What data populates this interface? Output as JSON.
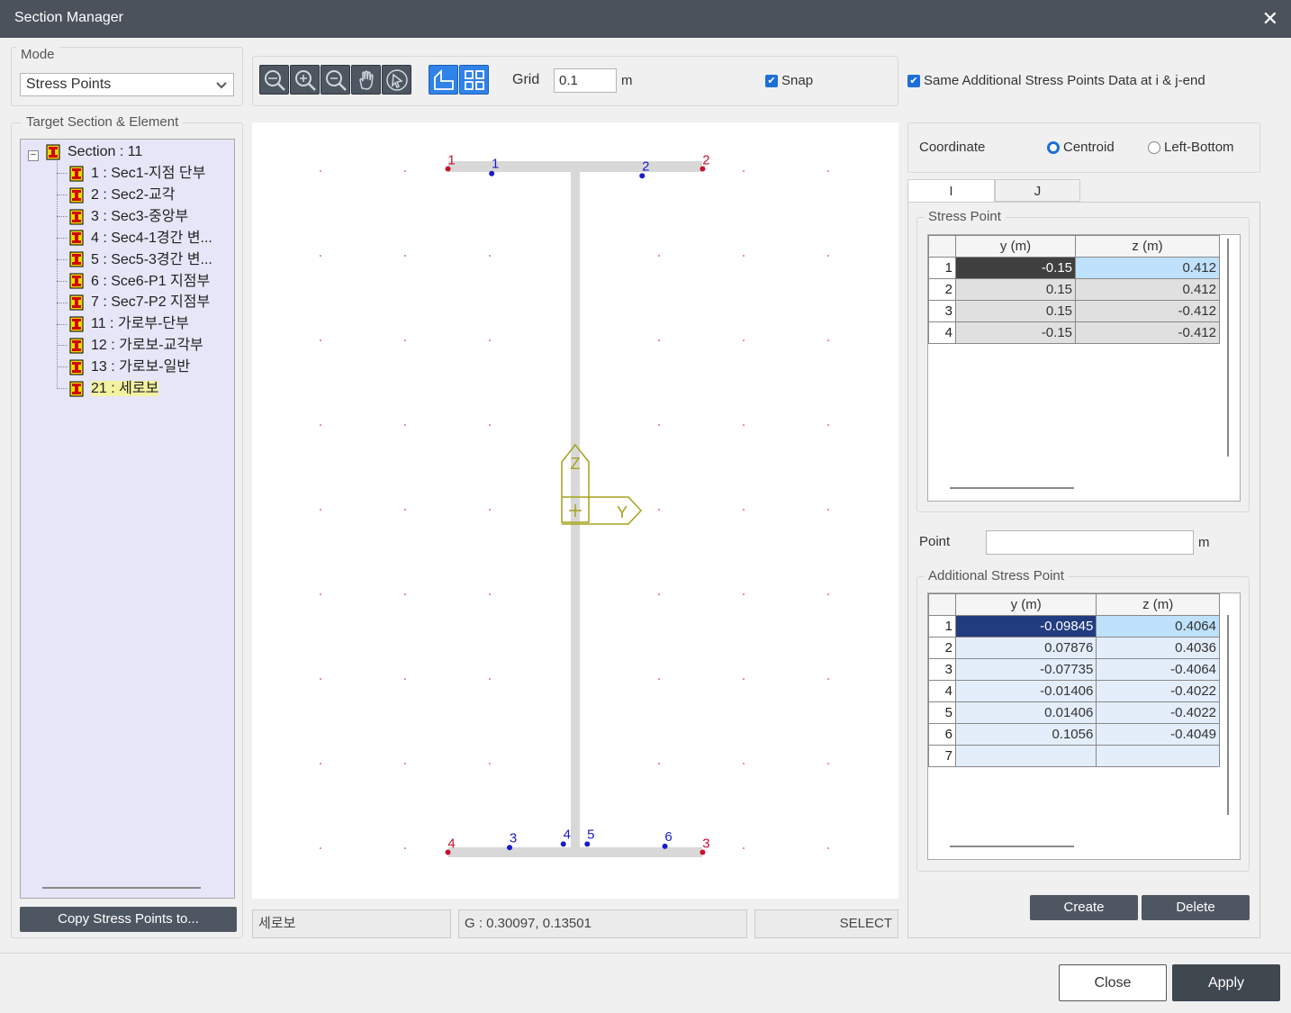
{
  "window": {
    "title": "Section Manager"
  },
  "mode": {
    "label": "Mode",
    "value": "Stress Points"
  },
  "toolbar": {
    "grid_label": "Grid",
    "grid_value": "0.1",
    "grid_unit": "m",
    "snap_label": "Snap",
    "same_label": "Same Additional Stress Points Data at i & j-end"
  },
  "target": {
    "label": "Target Section & Element",
    "root": "Section : 11",
    "items": [
      "1 : Sec1-지점 단부",
      "2 : Sec2-교각",
      "3 : Sec3-중앙부",
      "4 : Sec4-1경간 변...",
      "5 : Sec5-3경간 변...",
      "6 : Sce6-P1 지점부",
      "7 : Sec7-P2 지점부",
      "11 : 가로부-단부",
      "12 : 가로보-교각부",
      "13 : 가로보-일반",
      "21 : 세로보"
    ]
  },
  "copy_button": "Copy Stress Points to...",
  "statusbar": {
    "name": "세로보",
    "coord": "G : 0.30097, 0.13501",
    "mode": "SELECT"
  },
  "coordinate": {
    "label": "Coordinate",
    "opt1": "Centroid",
    "opt2": "Left-Bottom"
  },
  "tabs": [
    "I",
    "J"
  ],
  "stress": {
    "label": "Stress Point",
    "col_y": "y (m)",
    "col_z": "z (m)",
    "rows": [
      [
        "1",
        "-0.15",
        "0.412"
      ],
      [
        "2",
        "0.15",
        "0.412"
      ],
      [
        "3",
        "0.15",
        "-0.412"
      ],
      [
        "4",
        "-0.15",
        "-0.412"
      ]
    ]
  },
  "point": {
    "label": "Point",
    "unit": "m",
    "value": ""
  },
  "additional": {
    "label": "Additional Stress Point",
    "col_y": "y (m)",
    "col_z": "z (m)",
    "rows": [
      [
        "1",
        "-0.09845",
        "0.4064"
      ],
      [
        "2",
        "0.07876",
        "0.4036"
      ],
      [
        "3",
        "-0.07735",
        "-0.4064"
      ],
      [
        "4",
        "-0.01406",
        "-0.4022"
      ],
      [
        "5",
        "0.01406",
        "-0.4022"
      ],
      [
        "6",
        "0.1056",
        "-0.4049"
      ],
      [
        "7",
        "",
        ""
      ]
    ]
  },
  "buttons": {
    "create": "Create",
    "delete": "Delete",
    "close": "Close",
    "apply": "Apply"
  },
  "canvas": {
    "red_labels": [
      "1",
      "2",
      "4",
      "3"
    ],
    "blue_labels": [
      "1",
      "2",
      "3",
      "4",
      "5",
      "6"
    ],
    "axis_z": "Z",
    "axis_y": "Y",
    "colors": {
      "red": "#c8102e",
      "blue": "#1a1acd",
      "axis": "#a5a21a",
      "section": "#d8d8d8"
    }
  }
}
